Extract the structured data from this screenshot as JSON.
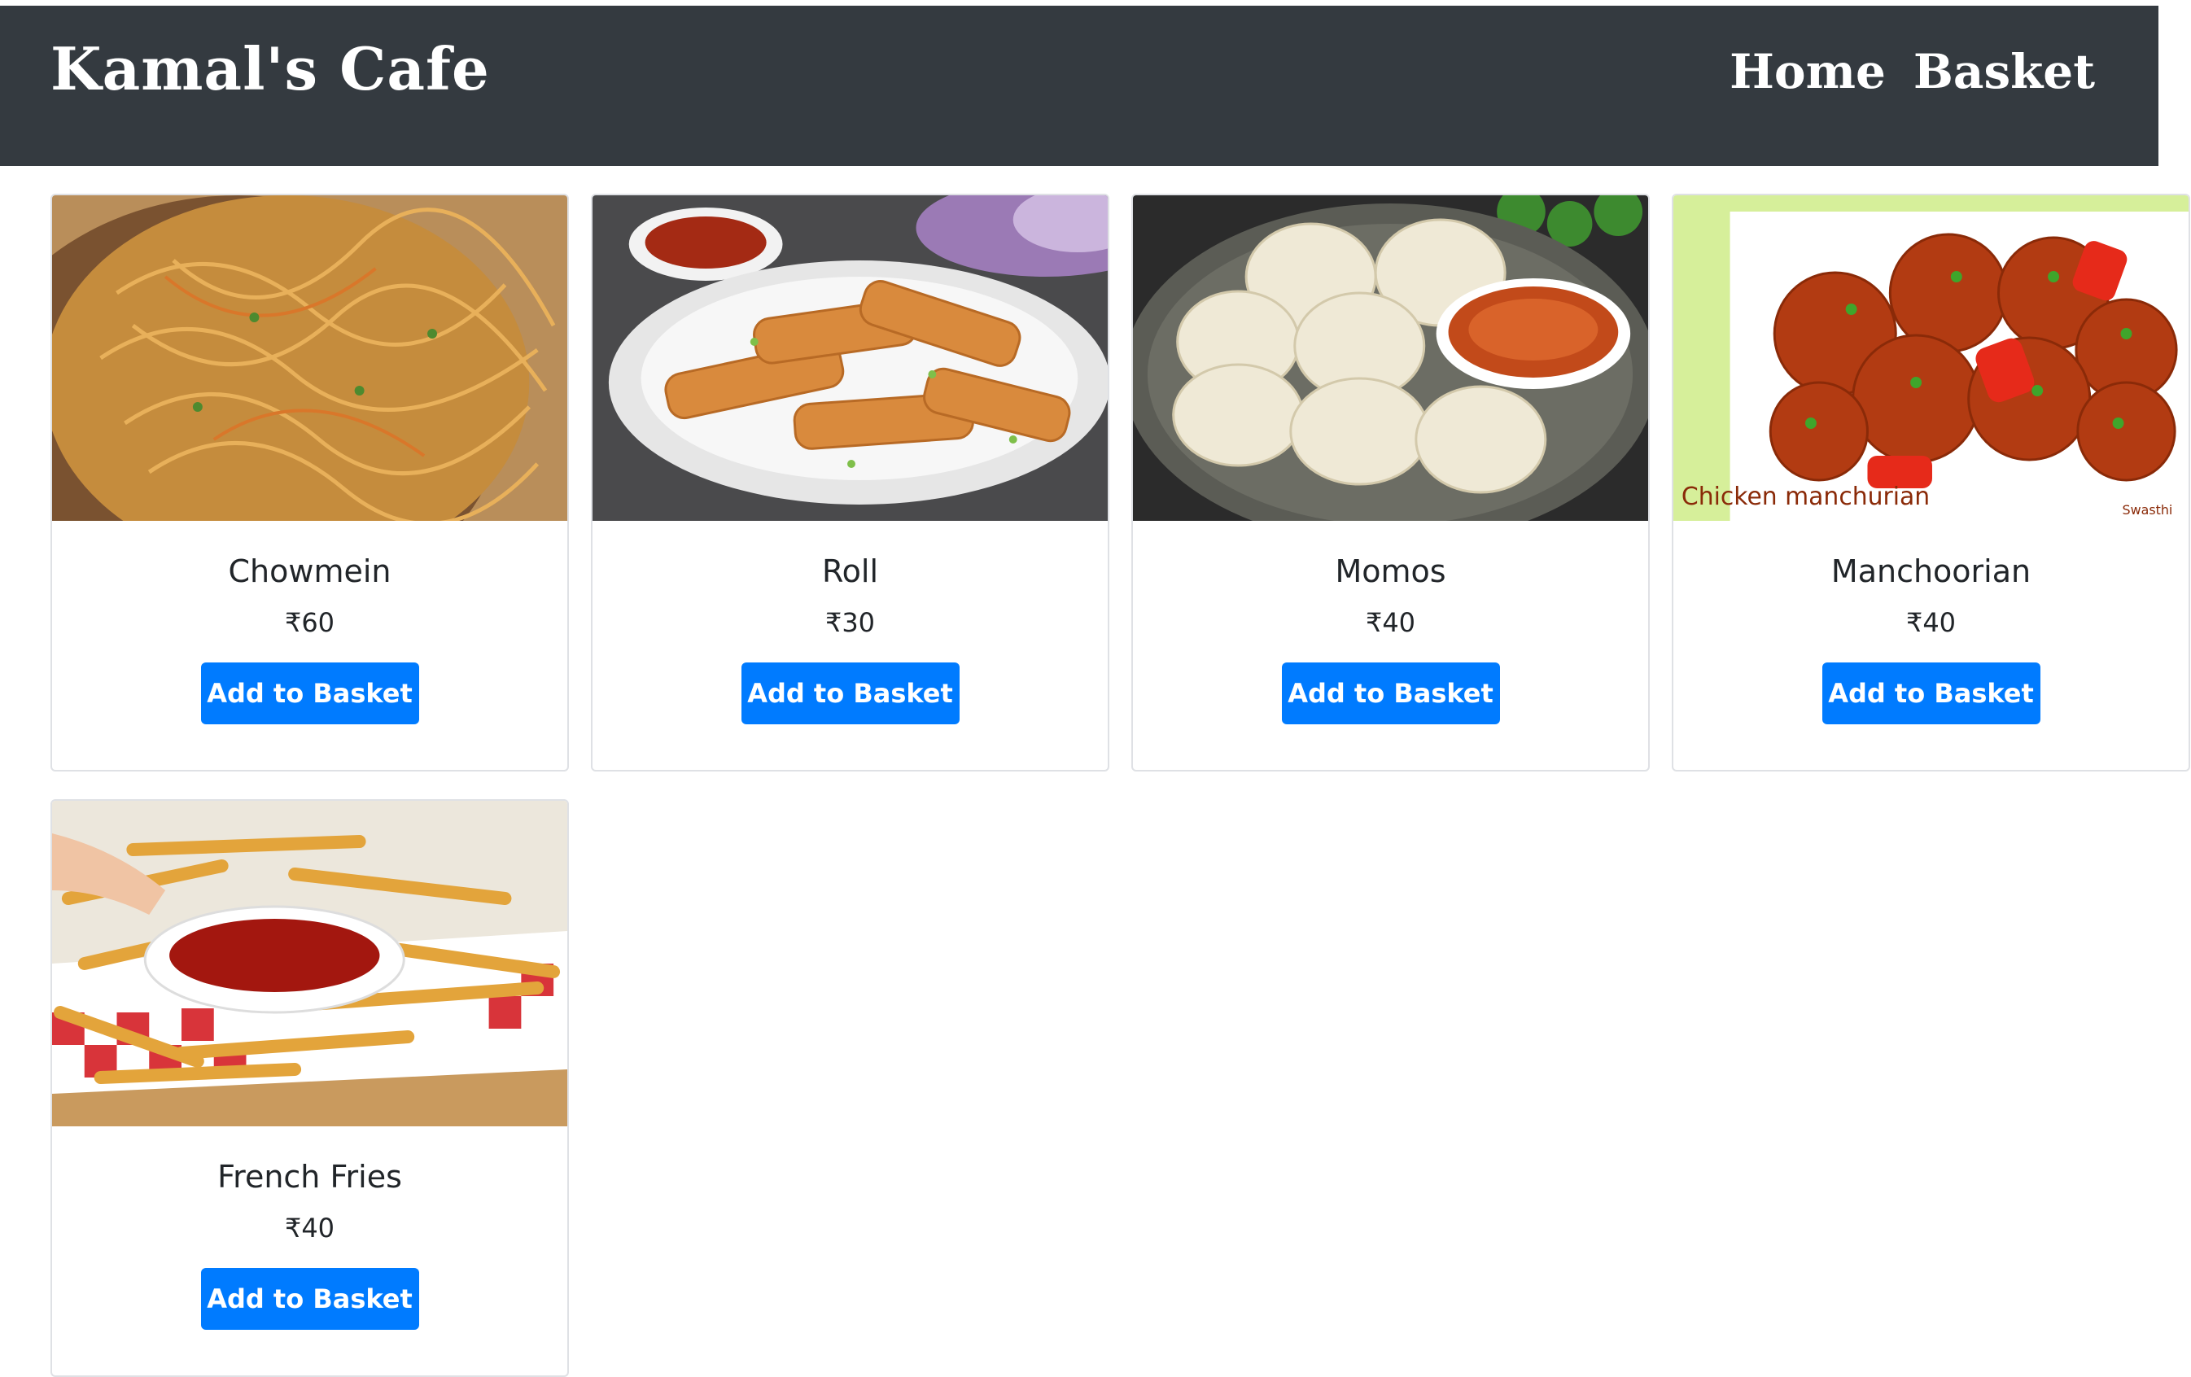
{
  "navbar": {
    "brand": "Kamal's Cafe",
    "links": [
      "Home",
      "Basket"
    ]
  },
  "currency_symbol": "₹",
  "items": [
    {
      "name": "Chowmein",
      "price": "₹60",
      "button": "Add to Basket",
      "image": "chowmein-image"
    },
    {
      "name": "Roll",
      "price": "₹30",
      "button": "Add to Basket",
      "image": "spring-roll-image"
    },
    {
      "name": "Momos",
      "price": "₹40",
      "button": "Add to Basket",
      "image": "momos-image"
    },
    {
      "name": "Manchoorian",
      "price": "₹40",
      "button": "Add to Basket",
      "image": "manchurian-image",
      "image_caption": "Chicken manchurian",
      "image_watermark": "Swasthi"
    },
    {
      "name": "French Fries",
      "price": "₹40",
      "button": "Add to Basket",
      "image": "french-fries-image"
    }
  ],
  "colors": {
    "navbar_bg": "#343a40",
    "button_bg": "#007bff",
    "card_border": "#dfe1e5"
  }
}
